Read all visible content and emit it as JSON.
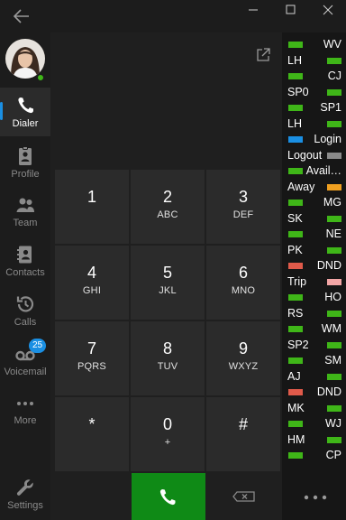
{
  "nav": {
    "items": [
      {
        "key": "dialer",
        "label": "Dialer",
        "icon": "phone-icon"
      },
      {
        "key": "profile",
        "label": "Profile",
        "icon": "id-badge-icon"
      },
      {
        "key": "team",
        "label": "Team",
        "icon": "team-icon"
      },
      {
        "key": "contacts",
        "label": "Contacts",
        "icon": "contacts-book-icon"
      },
      {
        "key": "calls",
        "label": "Calls",
        "icon": "history-icon"
      },
      {
        "key": "voicemail",
        "label": "Voicemail",
        "icon": "voicemail-icon",
        "badge": "25"
      },
      {
        "key": "more",
        "label": "More",
        "icon": "ellipsis-icon"
      },
      {
        "key": "settings",
        "label": "Settings",
        "icon": "wrench-icon"
      }
    ]
  },
  "keypad": {
    "keys": [
      {
        "digit": "1",
        "letters": ""
      },
      {
        "digit": "2",
        "letters": "ABC"
      },
      {
        "digit": "3",
        "letters": "DEF"
      },
      {
        "digit": "4",
        "letters": "GHI"
      },
      {
        "digit": "5",
        "letters": "JKL"
      },
      {
        "digit": "6",
        "letters": "MNO"
      },
      {
        "digit": "7",
        "letters": "PQRS"
      },
      {
        "digit": "8",
        "letters": "TUV"
      },
      {
        "digit": "9",
        "letters": "WXYZ"
      },
      {
        "digit": "*",
        "letters": ""
      },
      {
        "digit": "0",
        "letters": "+"
      },
      {
        "digit": "#",
        "letters": ""
      }
    ]
  },
  "status_panel": {
    "rows": [
      {
        "text": "WV",
        "color": "#3fb618",
        "bar_side": "left"
      },
      {
        "text": "LH",
        "color": "#3fb618",
        "bar_side": "right"
      },
      {
        "text": "CJ",
        "color": "#3fb618",
        "bar_side": "left"
      },
      {
        "text": "SP0",
        "color": "#3fb618",
        "bar_side": "right"
      },
      {
        "text": "SP1",
        "color": "#3fb618",
        "bar_side": "left"
      },
      {
        "text": "LH",
        "color": "#3fb618",
        "bar_side": "right"
      },
      {
        "text": "Login",
        "color": "#1a8fe3",
        "bar_side": "left"
      },
      {
        "text": "Logout",
        "color": "#8a8a8a",
        "bar_side": "right"
      },
      {
        "text": "Avail…",
        "color": "#3fb618",
        "bar_side": "left"
      },
      {
        "text": "Away",
        "color": "#f0a020",
        "bar_side": "right"
      },
      {
        "text": "MG",
        "color": "#3fb618",
        "bar_side": "left"
      },
      {
        "text": "SK",
        "color": "#3fb618",
        "bar_side": "right"
      },
      {
        "text": "NE",
        "color": "#3fb618",
        "bar_side": "left"
      },
      {
        "text": "PK",
        "color": "#3fb618",
        "bar_side": "right"
      },
      {
        "text": "DND",
        "color": "#e05a4a",
        "bar_side": "left"
      },
      {
        "text": "Trip",
        "color": "#f3a6a6",
        "bar_side": "right"
      },
      {
        "text": "HO",
        "color": "#3fb618",
        "bar_side": "left"
      },
      {
        "text": "RS",
        "color": "#3fb618",
        "bar_side": "right"
      },
      {
        "text": "WM",
        "color": "#3fb618",
        "bar_side": "left"
      },
      {
        "text": "SP2",
        "color": "#3fb618",
        "bar_side": "right"
      },
      {
        "text": "SM",
        "color": "#3fb618",
        "bar_side": "left"
      },
      {
        "text": "AJ",
        "color": "#3fb618",
        "bar_side": "right"
      },
      {
        "text": "DND",
        "color": "#e05a4a",
        "bar_side": "left"
      },
      {
        "text": "MK",
        "color": "#3fb618",
        "bar_side": "right"
      },
      {
        "text": "WJ",
        "color": "#3fb618",
        "bar_side": "left"
      },
      {
        "text": "HM",
        "color": "#3fb618",
        "bar_side": "right"
      },
      {
        "text": "CP",
        "color": "#3fb618",
        "bar_side": "left"
      }
    ]
  },
  "colors": {
    "accent": "#1a8fe3",
    "call_green": "#0f8a16",
    "available_green": "#3fb618"
  }
}
